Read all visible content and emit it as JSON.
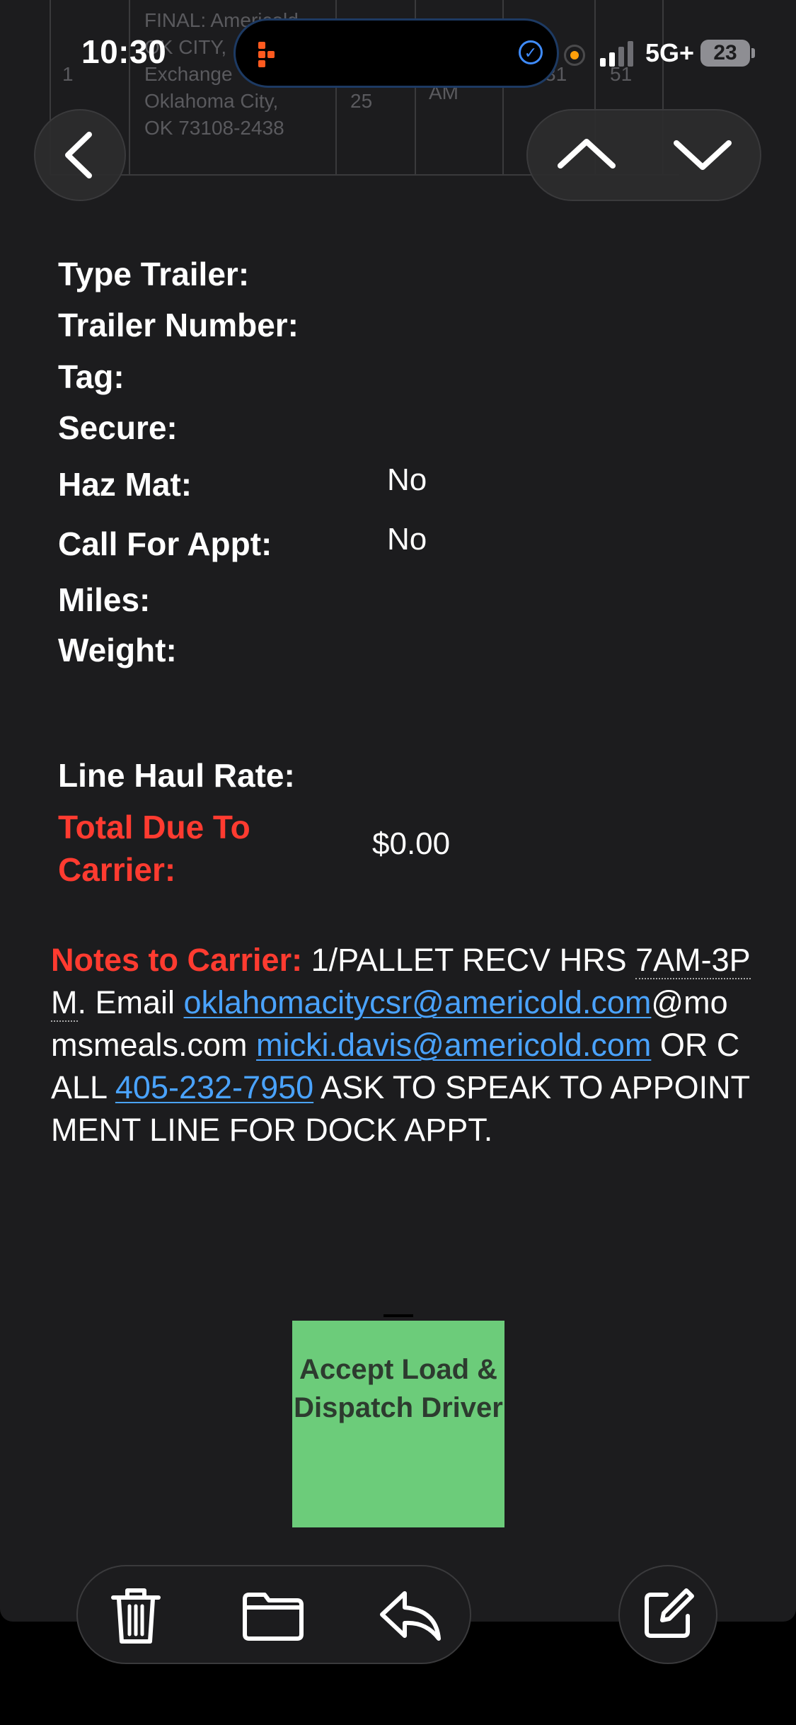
{
  "status_bar": {
    "time": "10:30",
    "network": "5G+",
    "battery": "23"
  },
  "background_table": {
    "row_number": "1",
    "address_lines": [
      "FINAL: Americold",
      "OK CITY,",
      "Exchange",
      "Oklahoma City,",
      "OK 73108-2438"
    ],
    "col2": "25",
    "col3": "AM",
    "col4": "31",
    "col5": "51"
  },
  "fields": {
    "type_trailer": {
      "label": "Type Trailer:",
      "value": ""
    },
    "trailer_number": {
      "label": "Trailer Number:",
      "value": ""
    },
    "tag": {
      "label": "Tag:",
      "value": ""
    },
    "secure": {
      "label": "Secure:",
      "value": ""
    },
    "haz_mat": {
      "label": "Haz Mat:",
      "value": "No"
    },
    "call_for_appt": {
      "label": "Call For Appt:",
      "value": "No"
    },
    "miles": {
      "label": "Miles:",
      "value": ""
    },
    "weight": {
      "label": "Weight:",
      "value": ""
    },
    "line_haul_rate": {
      "label": "Line Haul Rate:",
      "value": ""
    },
    "total_due": {
      "label": "Total Due To Carrier:",
      "value": "$0.00"
    }
  },
  "notes": {
    "label": "Notes to Carrier:",
    "text_1": " 1/PALLET RECV HRS ",
    "hours": "7AM-3PM",
    "text_2": ". Email ",
    "email_1": "oklahomacitycsr@americold.com",
    "text_3": "@momsmeals.com ",
    "email_2": "micki.davis@americold.com",
    "text_4": " OR CALL ",
    "phone": "405-232-7950",
    "text_5": " ASK TO SPEAK TO APPOINTMENT LINE FOR DOCK APPT."
  },
  "accept_button": {
    "label": "Accept Load & Dispatch Driver",
    "color": "#6ccc7a"
  },
  "icons": [
    "chevron-left",
    "chevron-up",
    "chevron-down",
    "trash",
    "folder",
    "reply",
    "compose"
  ],
  "colors": {
    "accent_red": "#ff3b30",
    "link_blue": "#4aa3ff",
    "background": "#1c1c1e"
  }
}
